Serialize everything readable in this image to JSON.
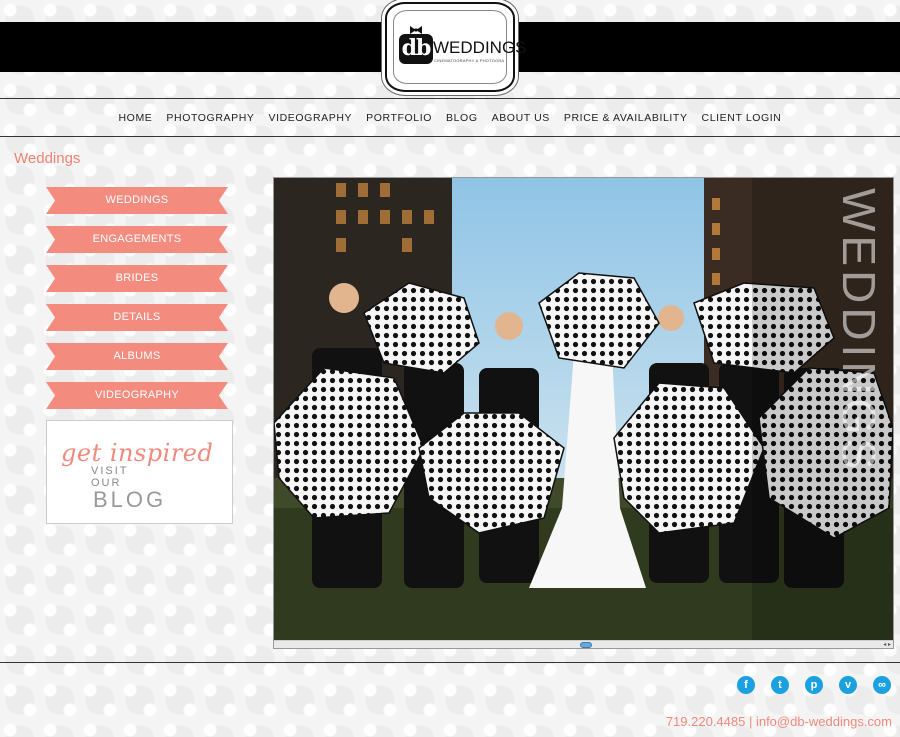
{
  "logo": {
    "mark": "db",
    "text": "WEDDINGS",
    "subtitle": "CINEMATOGRAPHY & PHOTOGRAPHY"
  },
  "nav": {
    "items": [
      {
        "label": "HOME"
      },
      {
        "label": "PHOTOGRAPHY"
      },
      {
        "label": "VIDEOGRAPHY"
      },
      {
        "label": "PORTFOLIO"
      },
      {
        "label": "BLOG"
      },
      {
        "label": "ABOUT US"
      },
      {
        "label": "PRICE & AVAILABILITY"
      },
      {
        "label": "CLIENT LOGIN"
      }
    ]
  },
  "page": {
    "title": "Weddings"
  },
  "sidebar": {
    "items": [
      {
        "label": "WEDDINGS"
      },
      {
        "label": "ENGAGEMENTS"
      },
      {
        "label": "BRIDES"
      },
      {
        "label": "DETAILS"
      },
      {
        "label": "ALBUMS"
      },
      {
        "label": "VIDEOGRAPHY"
      }
    ],
    "blog_promo": {
      "script": "get inspired",
      "line1": "VISIT",
      "line2": "OUR",
      "line3": "BLOG"
    }
  },
  "gallery": {
    "watermark": "WEDDINGS"
  },
  "footer": {
    "contact": "719.220.4485 | info@db-weddings.com",
    "socials": [
      {
        "icon": "facebook-icon",
        "glyph": "f"
      },
      {
        "icon": "twitter-icon",
        "glyph": "t"
      },
      {
        "icon": "pinterest-icon",
        "glyph": "p"
      },
      {
        "icon": "vimeo-icon",
        "glyph": "v"
      },
      {
        "icon": "link-icon",
        "glyph": "∞"
      }
    ]
  },
  "colors": {
    "accent": "#f38c7f",
    "header": "#000000",
    "social": "#1ba1e2"
  }
}
